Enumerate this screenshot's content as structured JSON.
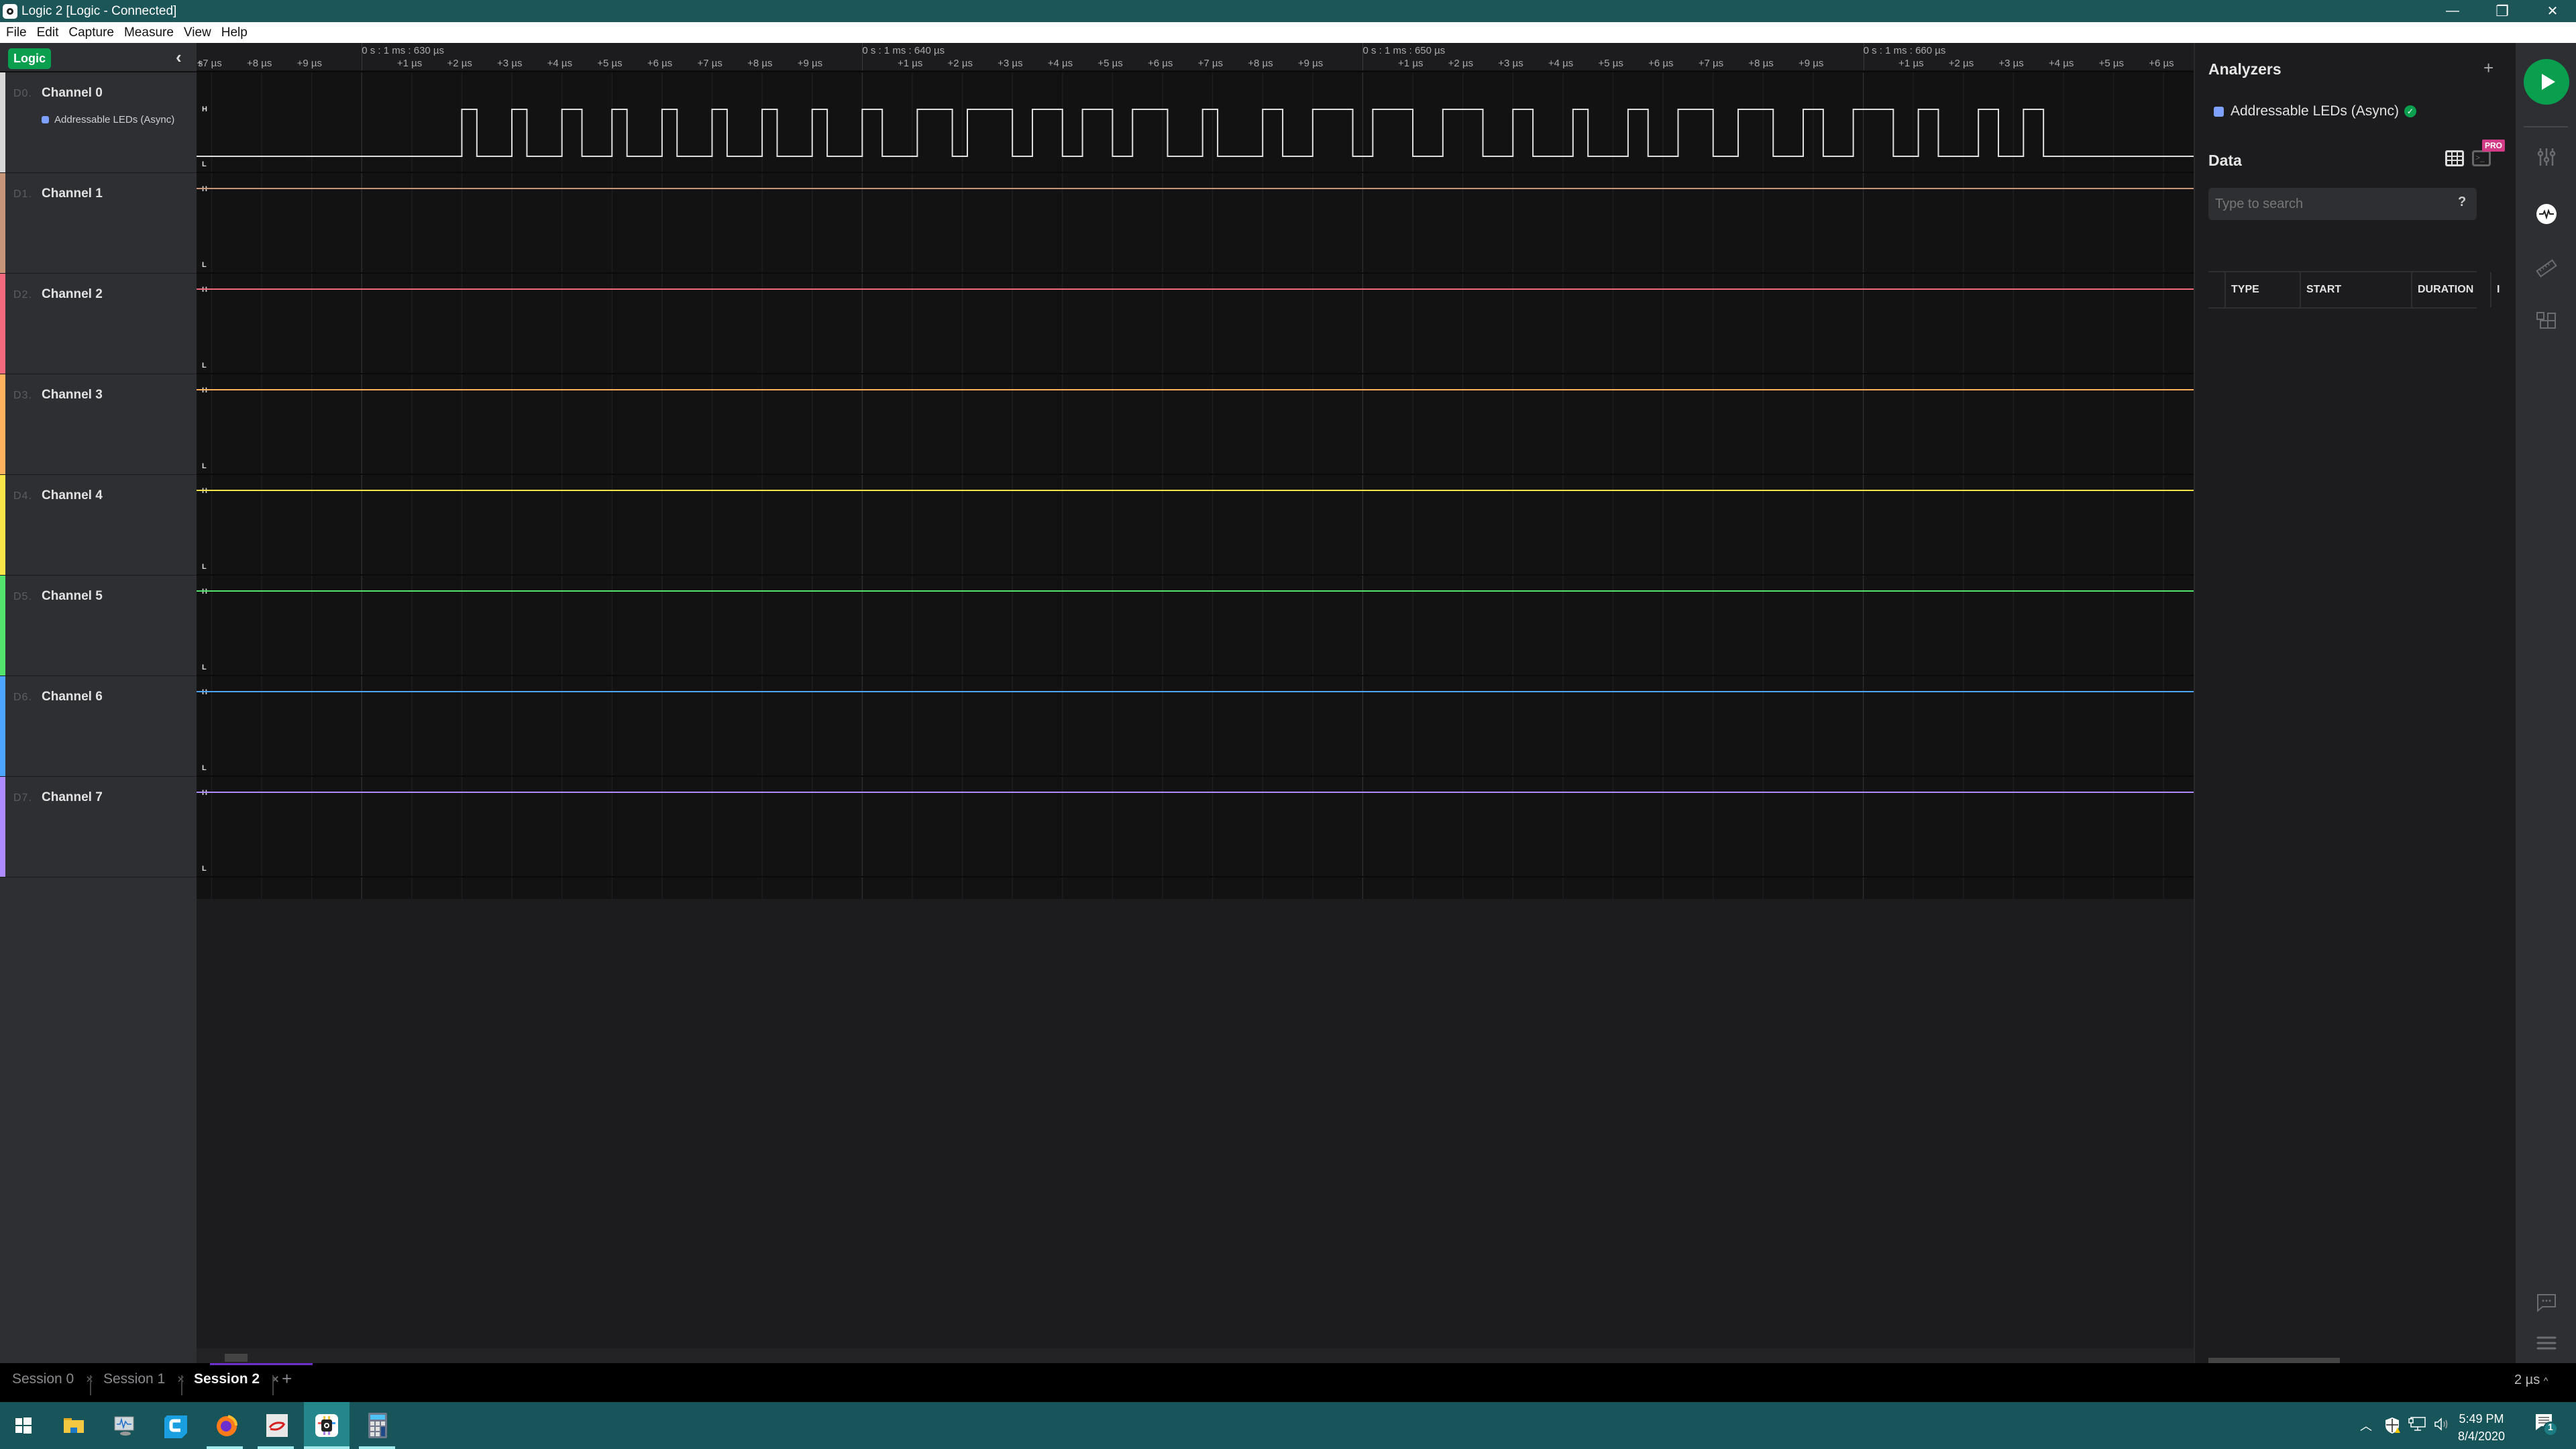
{
  "window": {
    "title": "Logic 2 [Logic - Connected]",
    "controls": {
      "minimize": "—",
      "restore": "❐",
      "close": "✕"
    }
  },
  "menu": [
    "File",
    "Edit",
    "Capture",
    "Measure",
    "View",
    "Help"
  ],
  "left_panel": {
    "badge": "Logic",
    "collapse_icon": "‹",
    "channels": [
      {
        "id": "D0.",
        "name": "Channel 0",
        "color": "#d8d8d8",
        "analyzer": "Addressable LEDs (Async)",
        "trace_color": "#e0e0e0"
      },
      {
        "id": "D1.",
        "name": "Channel 1",
        "color": "#c79577",
        "trace_color": "#c79577"
      },
      {
        "id": "D2.",
        "name": "Channel 2",
        "color": "#f3697d",
        "trace_color": "#f3697d"
      },
      {
        "id": "D3.",
        "name": "Channel 3",
        "color": "#ffb25e",
        "trace_color": "#ffb25e"
      },
      {
        "id": "D4.",
        "name": "Channel 4",
        "color": "#f9e547",
        "trace_color": "#f9e547"
      },
      {
        "id": "D5.",
        "name": "Channel 5",
        "color": "#52e46c",
        "trace_color": "#52e46c"
      },
      {
        "id": "D6.",
        "name": "Channel 6",
        "color": "#4ea5ff",
        "trace_color": "#4ea5ff"
      },
      {
        "id": "D7.",
        "name": "Channel 7",
        "color": "#ae8cff",
        "trace_color": "#ae8cff"
      }
    ],
    "level_high": "H",
    "level_low": "L"
  },
  "timeline": {
    "leading_ticks": [
      "s",
      "+7 µs",
      "+8 µs",
      "+9 µs"
    ],
    "majors": [
      {
        "label": "0 s : 1 ms : 630 µs",
        "ticks": [
          "+1 µs",
          "+2 µs",
          "+3 µs",
          "+4 µs",
          "+5 µs",
          "+6 µs",
          "+7 µs",
          "+8 µs",
          "+9 µs"
        ]
      },
      {
        "label": "0 s : 1 ms : 640 µs",
        "ticks": [
          "+1 µs",
          "+2 µs",
          "+3 µs",
          "+4 µs",
          "+5 µs",
          "+6 µs",
          "+7 µs",
          "+8 µs",
          "+9 µs"
        ]
      },
      {
        "label": "0 s : 1 ms : 650 µs",
        "ticks": [
          "+1 µs",
          "+2 µs",
          "+3 µs",
          "+4 µs",
          "+5 µs",
          "+6 µs",
          "+7 µs",
          "+8 µs",
          "+9 µs"
        ]
      },
      {
        "label": "0 s : 1 ms : 660 µs",
        "ticks": [
          "+1 µs",
          "+2 µs",
          "+3 µs",
          "+4 µs",
          "+5 µs",
          "+6 µs",
          "+"
        ]
      }
    ],
    "start_us": 1626.7,
    "end_us": 1666.6
  },
  "channel0_waveform": {
    "initial_level": 0,
    "transitions_us": [
      1632.0,
      1632.3,
      1633.0,
      1633.3,
      1634.0,
      1634.4,
      1635.0,
      1635.3,
      1636.0,
      1636.3,
      1637.0,
      1637.3,
      1638.0,
      1638.3,
      1639.0,
      1639.3,
      1640.0,
      1640.4,
      1641.1,
      1641.8,
      1642.1,
      1643.0,
      1643.4,
      1644.0,
      1644.4,
      1645.0,
      1645.4,
      1646.1,
      1646.8,
      1647.1,
      1648.0,
      1648.4,
      1649.0,
      1649.8,
      1650.2,
      1651.0,
      1651.6,
      1652.4,
      1653.0,
      1653.4,
      1654.2,
      1654.5,
      1655.3,
      1655.7,
      1656.3,
      1657.0,
      1657.5,
      1658.2,
      1658.8,
      1659.2,
      1659.8,
      1660.6,
      1661.1,
      1661.5,
      1662.3,
      1662.7,
      1663.2,
      1663.6
    ]
  },
  "right_panel": {
    "analyzers_title": "Analyzers",
    "add_icon": "+",
    "analyzers": [
      {
        "name": "Addressable LEDs (Async)",
        "color": "#7ea0ff",
        "status": "ok"
      }
    ],
    "data_title": "Data",
    "pro_badge": "PRO",
    "search_placeholder": "Type to search",
    "search_help": "?",
    "columns": [
      "TYPE",
      "START",
      "DURATION",
      "I"
    ]
  },
  "icon_strip": [
    "play-icon",
    "sliders-icon",
    "waveform-icon",
    "ruler-icon",
    "extensions-icon",
    "chat-icon",
    "menu-icon"
  ],
  "sessions": {
    "tabs": [
      {
        "label": "Session 0",
        "active": false
      },
      {
        "label": "Session 1",
        "active": false
      },
      {
        "label": "Session 2",
        "active": true
      }
    ],
    "add_icon": "+",
    "close_icon": "×",
    "zoom_level": "2 µs",
    "zoom_caret": "^"
  },
  "taskbar": {
    "time": "5:49 PM",
    "date": "8/4/2020",
    "notification_count": "1"
  }
}
